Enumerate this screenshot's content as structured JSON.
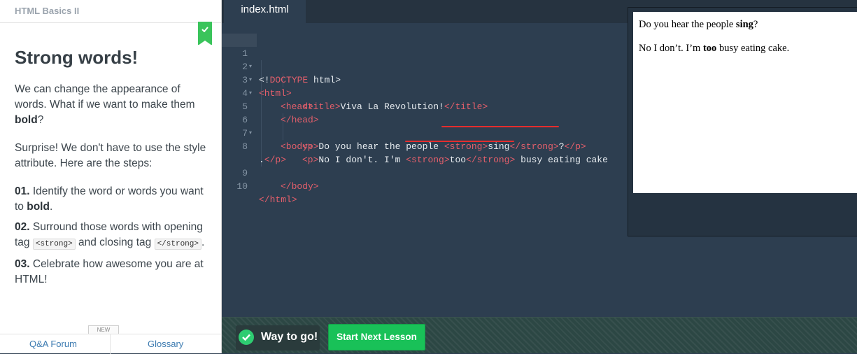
{
  "course": {
    "title": "HTML Basics II"
  },
  "lesson": {
    "title": "Strong words!",
    "para1_before": "We can change the appearance of words. What if we want to make them ",
    "para1_bold": "bold",
    "para1_after": "?",
    "para2": "Surprise! We don't have to use the style attribute. Here are the steps:",
    "step1_num": "01.",
    "step1_before": " Identify the word or words you want to ",
    "step1_bold": "bold",
    "step1_after": ".",
    "step2_num": "02.",
    "step2_before": " Surround those words with opening tag ",
    "step2_code_open": "<strong>",
    "step2_mid": " and closing tag ",
    "step2_code_close": "</strong>",
    "step2_after": ".",
    "step3_num": "03.",
    "step3_text": " Celebrate how awesome you are at HTML!",
    "mini_tab": "NEW"
  },
  "footer": {
    "qa_label": "Q&A Forum",
    "glossary_label": "Glossary"
  },
  "editor": {
    "tab_label": "index.html",
    "lines": [
      {
        "num": "1",
        "fold": "▾"
      },
      {
        "num": "2",
        "fold": "▾"
      },
      {
        "num": "3",
        "fold": "▾"
      },
      {
        "num": "4",
        "fold": ""
      },
      {
        "num": "5",
        "fold": ""
      },
      {
        "num": "6",
        "fold": "▾"
      },
      {
        "num": "7",
        "fold": ""
      },
      {
        "num": "8",
        "fold": ""
      },
      {
        "num": "",
        "fold": ""
      },
      {
        "num": "9",
        "fold": ""
      },
      {
        "num": "10",
        "fold": ""
      }
    ],
    "code": {
      "l1_a": "<!",
      "l1_b": "DOCTYPE",
      "l1_c": " html>",
      "l2": "<html>",
      "l3": "<head>",
      "l4_open": "<title>",
      "l4_text": "Viva La Revolution!",
      "l4_close": "</title>",
      "l5": "</head>",
      "l6": "<body>",
      "l7_p": "<p>",
      "l7_text": "Do you hear the people ",
      "l7_s_open": "<strong>",
      "l7_word": "sing",
      "l7_s_close": "</strong>",
      "l7_q": "?",
      "l7_p_close": "</p>",
      "l8_p": "<p>",
      "l8_text": "No I don't. I'm ",
      "l8_s_open": "<strong>",
      "l8_word": "too",
      "l8_s_close": "</strong>",
      "l8_rest": " busy eating cake",
      "l8b_dot": ".",
      "l8b_close": "</p>",
      "l9": "</body>",
      "l10": "</html>"
    }
  },
  "preview": {
    "p1_before": "Do you hear the people ",
    "p1_bold": "sing",
    "p1_after": "?",
    "p2_before": "No I don’t. I’m ",
    "p2_bold": "too",
    "p2_after": " busy eating cake."
  },
  "banner": {
    "success_text": "Way to go!",
    "next_button": "Start Next Lesson"
  },
  "colors": {
    "accent_green": "#19c158",
    "tag_red": "#e35f6b",
    "editor_bg": "#2d3e50"
  }
}
